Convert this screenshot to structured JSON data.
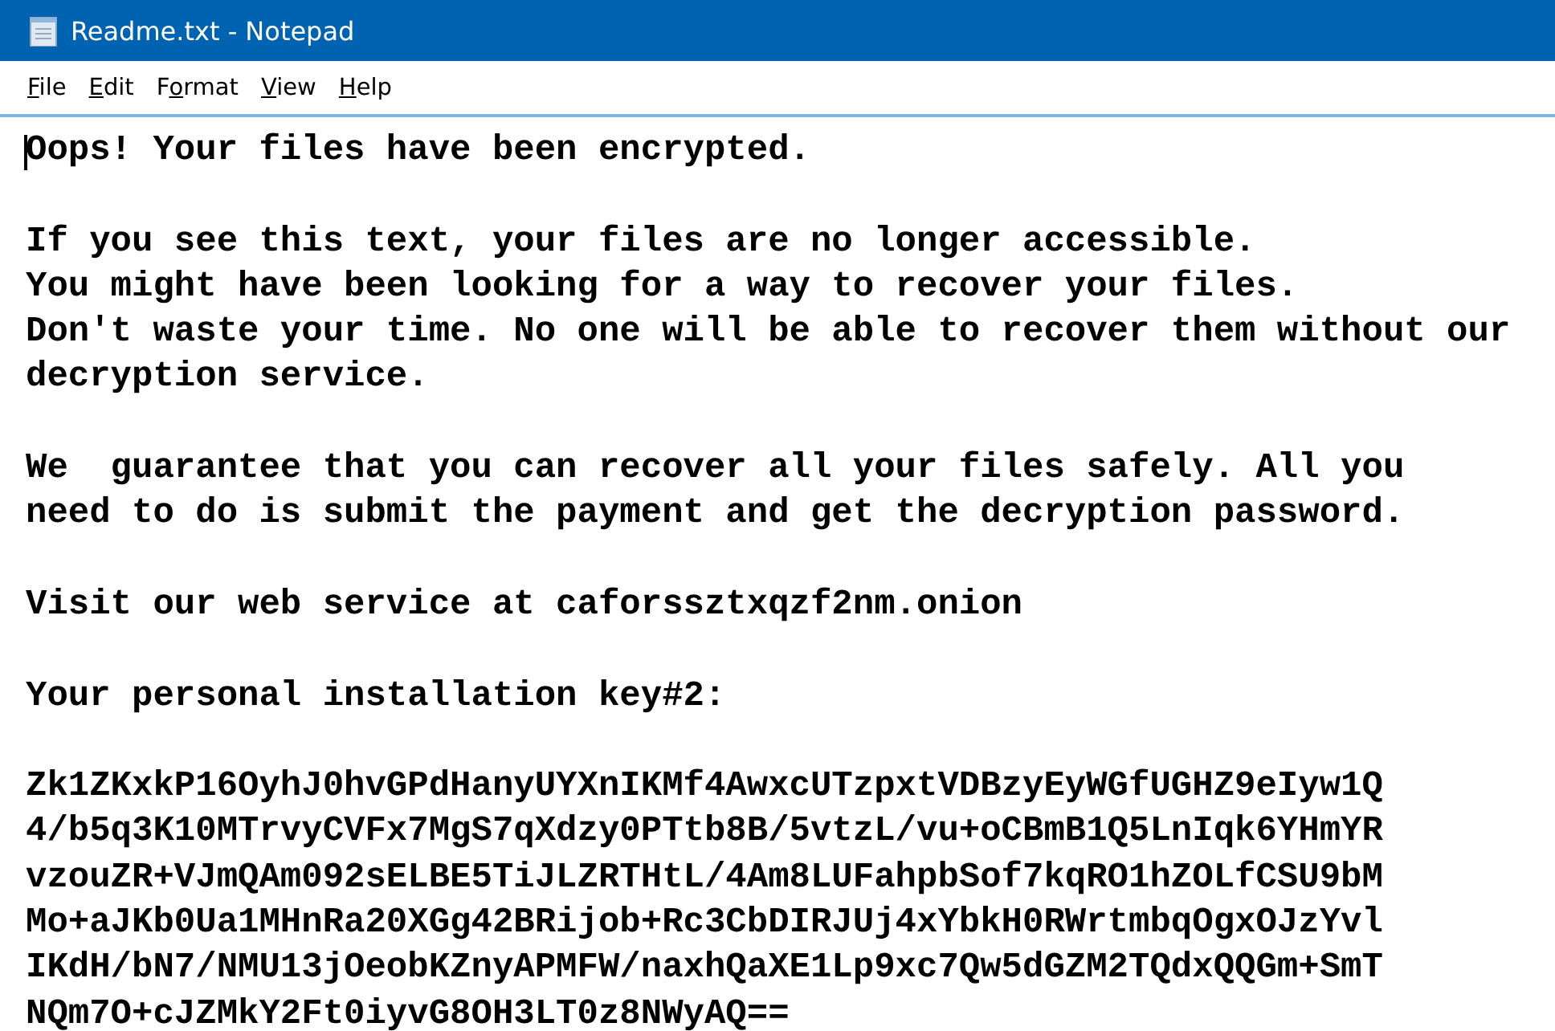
{
  "window": {
    "title": "Readme.txt - Notepad"
  },
  "menu": [
    {
      "access_key": "F",
      "rest": "ile"
    },
    {
      "access_key": "E",
      "rest": "dit"
    },
    {
      "lead": "F",
      "access_key": "o",
      "rest": "rmat"
    },
    {
      "access_key": "V",
      "rest": "iew"
    },
    {
      "access_key": "H",
      "rest": "elp"
    }
  ],
  "document": {
    "paragraphs": [
      [
        "Oops! Your files have been encrypted."
      ],
      [
        "If you see this text, your files are no longer accessible.",
        "You might have been looking for a way to recover your files.",
        "Don't waste your time. No one will be able to recover them without our",
        "decryption service."
      ],
      [
        "We  guarantee that you can recover all your files safely. All you",
        "need to do is submit the payment and get the decryption password."
      ],
      [
        "Visit our web service at caforssztxqzf2nm.onion"
      ],
      [
        "Your personal installation key#2:"
      ],
      [
        "Zk1ZKxkP16OyhJ0hvGPdHanyUYXnIKMf4AwxcUTzpxtVDBzyEyWGfUGHZ9eIyw1Q",
        "4/b5q3K10MTrvyCVFx7MgS7qXdzy0PTtb8B/5vtzL/vu+oCBmB1Q5LnIqk6YHmYR",
        "vzouZR+VJmQAm092sELBE5TiJLZRTHtL/4Am8LUFahpbSof7kqRO1hZOLfCSU9bM",
        "Mo+aJKb0Ua1MHnRa20XGg42BRijob+Rc3CbDIRJUj4xYbkH0RWrtmbqOgxOJzYvl",
        "IKdH/bN7/NMU13jOeobKZnyAPMFW/naxhQaXE1Lp9xc7Qw5dGZM2TQdxQQGm+SmT",
        "NQm7O+cJZMkY2Ft0iyvG8OH3LT0z8NWyAQ=="
      ]
    ]
  }
}
